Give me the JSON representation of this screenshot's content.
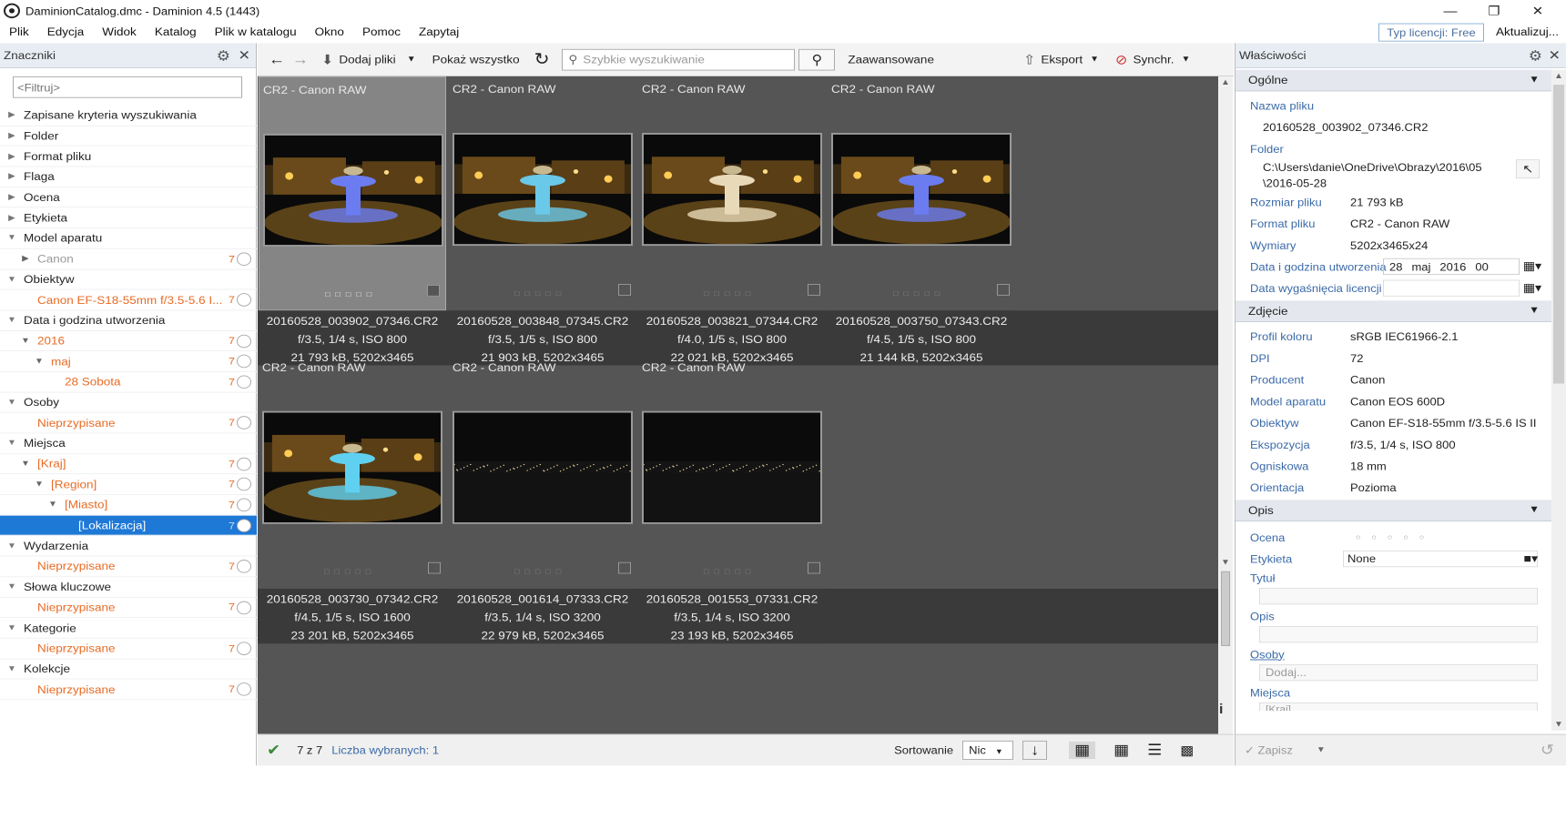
{
  "window": {
    "title": "DaminionCatalog.dmc - Daminion 4.5 (1443)"
  },
  "menu": [
    "Plik",
    "Edycja",
    "Widok",
    "Katalog",
    "Plik w katalogu",
    "Okno",
    "Pomoc",
    "Zapytaj"
  ],
  "license": "Typ licencji: Free",
  "update": "Aktualizuj...",
  "left": {
    "title": "Znaczniki",
    "filter_placeholder": "<Filtruj>",
    "tree": [
      {
        "label": "Zapisane kryteria wyszukiwania",
        "level": 0,
        "kind": "cat",
        "exp": false
      },
      {
        "label": "Folder",
        "level": 0,
        "kind": "cat",
        "exp": false
      },
      {
        "label": "Format pliku",
        "level": 0,
        "kind": "cat",
        "exp": false
      },
      {
        "label": "Flaga",
        "level": 0,
        "kind": "cat",
        "exp": false
      },
      {
        "label": "Ocena",
        "level": 0,
        "kind": "cat",
        "exp": false
      },
      {
        "label": "Etykieta",
        "level": 0,
        "kind": "cat",
        "exp": false
      },
      {
        "label": "Model aparatu",
        "level": 0,
        "kind": "cat",
        "exp": true
      },
      {
        "label": "Canon",
        "level": 1,
        "kind": "gray",
        "exp": false,
        "count": "7"
      },
      {
        "label": "Obiektyw",
        "level": 0,
        "kind": "cat",
        "exp": true
      },
      {
        "label": "Canon EF-S18-55mm f/3.5-5.6 I...",
        "level": 1,
        "kind": "sub",
        "count": "7"
      },
      {
        "label": "Data i godzina utworzenia",
        "level": 0,
        "kind": "cat",
        "exp": true
      },
      {
        "label": "2016",
        "level": 1,
        "kind": "sub",
        "exp": true,
        "count": "7"
      },
      {
        "label": "maj",
        "level": 2,
        "kind": "sub",
        "exp": true,
        "count": "7"
      },
      {
        "label": "28 Sobota",
        "level": 3,
        "kind": "sub",
        "count": "7"
      },
      {
        "label": "Osoby",
        "level": 0,
        "kind": "cat",
        "exp": true
      },
      {
        "label": "Nieprzypisane",
        "level": 1,
        "kind": "sub",
        "count": "7"
      },
      {
        "label": "Miejsca",
        "level": 0,
        "kind": "cat",
        "exp": true
      },
      {
        "label": "[Kraj]",
        "level": 1,
        "kind": "sub",
        "exp": true,
        "count": "7"
      },
      {
        "label": "[Region]",
        "level": 2,
        "kind": "sub",
        "exp": true,
        "count": "7"
      },
      {
        "label": "[Miasto]",
        "level": 3,
        "kind": "sub",
        "exp": true,
        "count": "7"
      },
      {
        "label": "[Lokalizacja]",
        "level": 4,
        "kind": "sel",
        "count": "7"
      },
      {
        "label": "Wydarzenia",
        "level": 0,
        "kind": "cat",
        "exp": true
      },
      {
        "label": "Nieprzypisane",
        "level": 1,
        "kind": "sub",
        "count": "7"
      },
      {
        "label": "Słowa kluczowe",
        "level": 0,
        "kind": "cat",
        "exp": true
      },
      {
        "label": "Nieprzypisane",
        "level": 1,
        "kind": "sub",
        "count": "7"
      },
      {
        "label": "Kategorie",
        "level": 0,
        "kind": "cat",
        "exp": true
      },
      {
        "label": "Nieprzypisane",
        "level": 1,
        "kind": "sub",
        "count": "7"
      },
      {
        "label": "Kolekcje",
        "level": 0,
        "kind": "cat",
        "exp": true
      },
      {
        "label": "Nieprzypisane",
        "level": 1,
        "kind": "sub",
        "count": "7"
      }
    ]
  },
  "toolbar": {
    "add": "Dodaj pliki",
    "showall": "Pokaż wszystko",
    "search_placeholder": "Szybkie wyszukiwanie",
    "advanced": "Zaawansowane",
    "export": "Eksport",
    "sync": "Synchr."
  },
  "items": [
    {
      "type": "CR2 - Canon RAW",
      "name": "20160528_003902_07346.CR2",
      "exif": "f/3.5, 1/4 s, ISO 800",
      "size": "21 793 kB, 5202x3465",
      "scene": "fountain-blue",
      "selected": true
    },
    {
      "type": "CR2 - Canon RAW",
      "name": "20160528_003848_07345.CR2",
      "exif": "f/3.5, 1/5 s, ISO 800",
      "size": "21 903 kB, 5202x3465",
      "scene": "fountain-cyan"
    },
    {
      "type": "CR2 - Canon RAW",
      "name": "20160528_003821_07344.CR2",
      "exif": "f/4.0, 1/5 s, ISO 800",
      "size": "22 021 kB, 5202x3465",
      "scene": "fountain-white"
    },
    {
      "type": "CR2 - Canon RAW",
      "name": "20160528_003750_07343.CR2",
      "exif": "f/4.5, 1/5 s, ISO 800",
      "size": "21 144 kB, 5202x3465",
      "scene": "fountain-blue"
    },
    {
      "type": "CR2 - Canon RAW",
      "name": "20160528_003730_07342.CR2",
      "exif": "f/4.5, 1/5 s, ISO 1600",
      "size": "23 201 kB, 5202x3465",
      "scene": "fountain-cyan2"
    },
    {
      "type": "CR2 - Canon RAW",
      "name": "20160528_001614_07333.CR2",
      "exif": "f/3.5, 1/4 s, ISO 3200",
      "size": "22 979 kB, 5202x3465",
      "scene": "night-city"
    },
    {
      "type": "CR2 - Canon RAW",
      "name": "20160528_001553_07331.CR2",
      "exif": "f/3.5, 1/4 s, ISO 3200",
      "size": "23 193 kB, 5202x3465",
      "scene": "night-city"
    }
  ],
  "status": {
    "count": "7 z 7",
    "selected": "Liczba wybranych: 1",
    "sort_label": "Sortowanie",
    "sort_value": "Nic"
  },
  "right": {
    "title": "Właściwości",
    "general": "Ogólne",
    "filename_label": "Nazwa pliku",
    "filename": "20160528_003902_07346.CR2",
    "folder_label": "Folder",
    "folder1": "C:\\Users\\danie\\OneDrive\\Obrazy\\2016\\05",
    "folder2": "\\2016-05-28",
    "props1": [
      {
        "label": "Rozmiar pliku",
        "value": "21 793 kB"
      },
      {
        "label": "Format pliku",
        "value": "CR2 - Canon RAW"
      },
      {
        "label": "Wymiary",
        "value": "5202x3465x24"
      }
    ],
    "created_label": "Data i godzina utworzenia",
    "created_day": "28",
    "created_month": "maj",
    "created_year": "2016",
    "created_rest": "00",
    "expiry_label": "Data wygaśnięcia licencji",
    "photo": "Zdjęcie",
    "props2": [
      {
        "label": "Profil koloru",
        "value": "sRGB IEC61966-2.1"
      },
      {
        "label": "DPI",
        "value": "72"
      },
      {
        "label": "Producent",
        "value": "Canon"
      },
      {
        "label": "Model aparatu",
        "value": "Canon EOS 600D"
      },
      {
        "label": "Obiektyw",
        "value": "Canon EF-S18-55mm f/3.5-5.6 IS II"
      },
      {
        "label": "Ekspozycja",
        "value": "f/3.5, 1/4 s, ISO 800"
      },
      {
        "label": "Ogniskowa",
        "value": "18 mm"
      },
      {
        "label": "Orientacja",
        "value": "Pozioma"
      }
    ],
    "desc": "Opis",
    "rating_label": "Ocena",
    "label_label": "Etykieta",
    "label_value": "None",
    "title_label": "Tytuł",
    "opis_label": "Opis",
    "people_label": "Osoby",
    "people_placeholder": "Dodaj...",
    "places_label": "Miejsca",
    "places_value": "[Kraj]",
    "save": "Zapisz"
  }
}
